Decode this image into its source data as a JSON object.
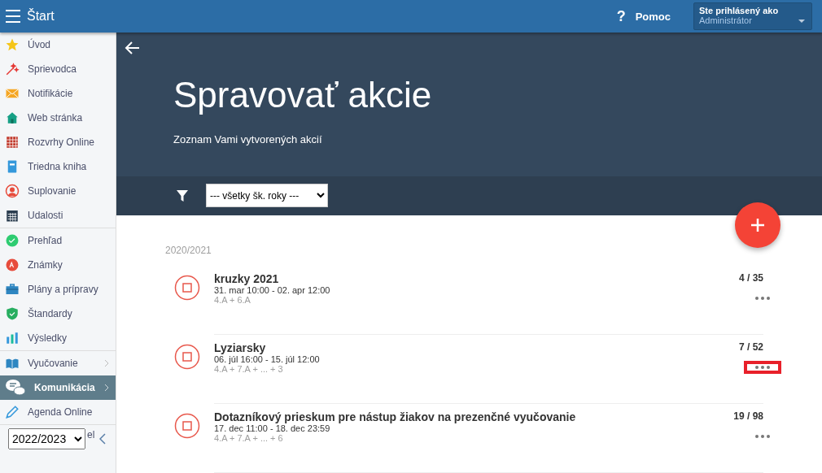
{
  "topbar": {
    "title": "Štart",
    "help_icon": "?",
    "help": "Pomoc",
    "user_label": "Ste prihlásený ako",
    "user_name": "Administrátor"
  },
  "sidebar": {
    "groups": [
      [
        {
          "label": "Úvod",
          "selected": false,
          "submenu": false
        },
        {
          "label": "Sprievodca",
          "selected": false,
          "submenu": false
        },
        {
          "label": "Notifikácie",
          "selected": false,
          "submenu": false
        },
        {
          "label": "Web stránka",
          "selected": false,
          "submenu": false
        },
        {
          "label": "Rozvrhy Online",
          "selected": false,
          "submenu": false
        },
        {
          "label": "Triedna kniha",
          "selected": false,
          "submenu": false
        },
        {
          "label": "Suplovanie",
          "selected": false,
          "submenu": false
        },
        {
          "label": "Udalosti",
          "selected": false,
          "submenu": false
        }
      ],
      [
        {
          "label": "Prehľad",
          "selected": false,
          "submenu": false
        },
        {
          "label": "Známky",
          "selected": false,
          "submenu": false
        },
        {
          "label": "Plány a prípravy",
          "selected": false,
          "submenu": false
        },
        {
          "label": "Štandardy",
          "selected": false,
          "submenu": false
        },
        {
          "label": "Výsledky",
          "selected": false,
          "submenu": false
        }
      ],
      [
        {
          "label": "Vyučovanie",
          "selected": false,
          "submenu": true
        },
        {
          "label": "Komunikácia",
          "selected": true,
          "submenu": true
        },
        {
          "label": "Agenda Online",
          "selected": false,
          "submenu": false
        }
      ]
    ],
    "footer": {
      "year": "2022/2023",
      "hidden_label": "el"
    }
  },
  "header": {
    "title": "Spravovať akcie",
    "subtitle": "Zoznam Vami vytvorených akcií",
    "filter": "--- všetky šk. roky ---"
  },
  "sections": [
    {
      "year": "2020/2021",
      "events": [
        {
          "title": "kruzky 2021",
          "dates": "31. mar 10:00 - 02. apr 12:00",
          "classes": "4.A + 6.A",
          "count": "4 / 35",
          "highlighted": false
        },
        {
          "title": "Lyziarsky",
          "dates": "06. júl 16:00 - 15. júl 12:00",
          "classes": "4.A + 7.A + ... + 3",
          "count": "7 / 52",
          "highlighted": true
        },
        {
          "title": "Dotazníkový prieskum pre nástup žiakov na prezenčné vyučovanie",
          "dates": "17. dec 11:00 - 18. dec 23:59",
          "classes": "4.A + 7.A + ... + 6",
          "count": "19 / 98",
          "highlighted": false
        }
      ]
    }
  ]
}
